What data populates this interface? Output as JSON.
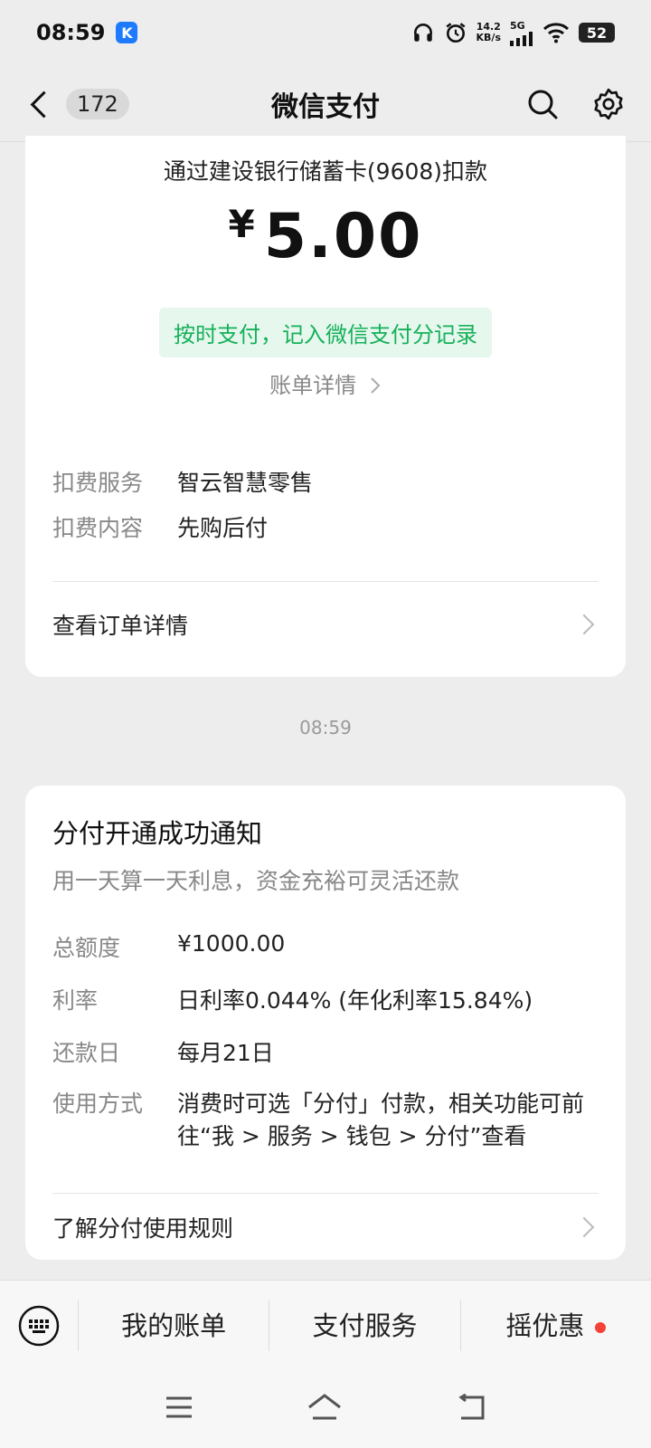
{
  "status_bar": {
    "time": "08:59",
    "app_badge": "K",
    "speed_value": "14.2",
    "speed_unit": "KB/s",
    "network": "5G",
    "battery": "52"
  },
  "header": {
    "unread_count": "172",
    "title": "微信支付"
  },
  "payment_card": {
    "pay_via": "通过建设银行储蓄卡(9608)扣款",
    "currency_symbol": "¥",
    "amount": "5.00",
    "ontime_notice": "按时支付，记入微信支付分记录",
    "bill_detail_link": "账单详情",
    "rows": [
      {
        "key": "扣费服务",
        "value": "智云智慧零售"
      },
      {
        "key": "扣费内容",
        "value": "先购后付"
      }
    ],
    "order_detail_link": "查看订单详情"
  },
  "timestamp": "08:59",
  "fenfu_card": {
    "title": "分付开通成功通知",
    "subtitle": "用一天算一天利息，资金充裕可灵活还款",
    "rows": [
      {
        "key": "总额度",
        "value": "¥1000.00"
      },
      {
        "key": "利率",
        "value": "日利率0.044% (年化利率15.84%)"
      },
      {
        "key": "还款日",
        "value": "每月21日"
      },
      {
        "key": "使用方式",
        "value": "消费时可选「分付」付款，相关功能可前往“我 > 服务 > 钱包 > 分付”查看"
      }
    ],
    "rules_link": "了解分付使用规则"
  },
  "bottom_menu": {
    "items": [
      {
        "label": "我的账单"
      },
      {
        "label": "支付服务"
      },
      {
        "label": "摇优惠"
      }
    ]
  },
  "colors": {
    "accent_green": "#16b15a",
    "badge_green_bg": "#e6f7ed",
    "notification_red": "#f44336"
  }
}
